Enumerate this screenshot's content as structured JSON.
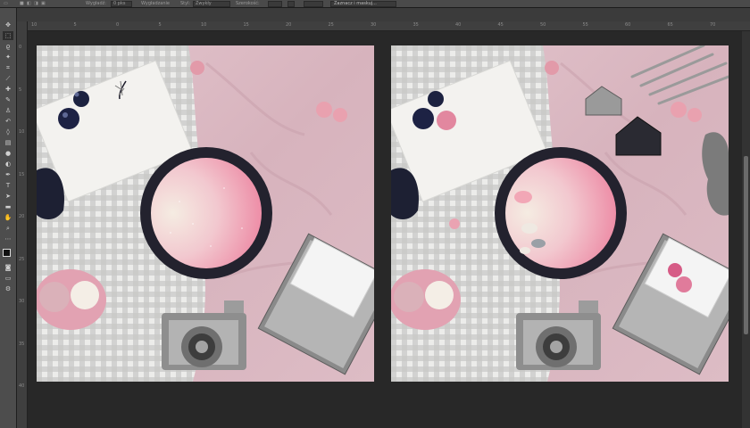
{
  "options_bar": {
    "width_label": "Wygładź:",
    "width_value": "0 pks",
    "antialias_label": "Wygładzanie",
    "style_label": "Styl:",
    "style_value": "Zwykły",
    "height_label": "Szerokość:",
    "select_mask_label": "Zaznacz i maskuj..."
  },
  "ruler_top_ticks": [
    "10",
    "5",
    "0",
    "5",
    "10",
    "15",
    "20",
    "25",
    "30",
    "35",
    "40",
    "45",
    "50",
    "55",
    "60",
    "65",
    "70"
  ],
  "ruler_left_ticks": [
    "0",
    "5",
    "10",
    "15",
    "20",
    "25",
    "30",
    "35",
    "40"
  ],
  "toolbar": {
    "tools": [
      "move-tool",
      "marquee-tool",
      "lasso-tool",
      "magic-wand-tool",
      "crop-tool",
      "eyedropper-tool",
      "healing-brush-tool",
      "brush-tool",
      "clone-stamp-tool",
      "history-brush-tool",
      "eraser-tool",
      "gradient-tool",
      "blur-tool",
      "dodge-tool",
      "pen-tool",
      "type-tool",
      "path-selection-tool",
      "shape-tool",
      "hand-tool",
      "zoom-tool"
    ],
    "foreground_color": "#111111",
    "background_color": "#ffffff"
  },
  "colors": {
    "blanket": "#dcbcc6",
    "gingham": "#dcdcd8",
    "plate_rim": "#23222e",
    "plate_pink": "#ef8ba6",
    "plate_cream": "#f3e3d8",
    "canvas_bg": "#282828"
  }
}
